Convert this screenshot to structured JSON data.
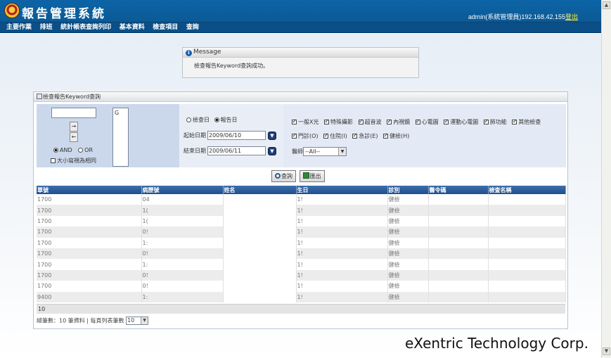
{
  "app": {
    "title": "報告管理系統",
    "user_info": "admin(系統管理員)192.168.42.155",
    "logout": "登出"
  },
  "menu": [
    "主要作業",
    "排班",
    "統計帳表查詢列印",
    "基本資料",
    "檢查項目",
    "查詢"
  ],
  "message": {
    "title": "Message",
    "text": "檢查報告Keyword查詢成功。"
  },
  "panel": {
    "title": "檢查報告Keyword查詢",
    "keyword_input": "",
    "keyword_list": "G",
    "add_arrow": "→",
    "remove_arrow": "←",
    "and_label": "AND",
    "or_label": "OR",
    "logic_selected": "AND",
    "case_label": "大小寫視為相同",
    "date_type": {
      "check_date": "檢查日",
      "report_date": "報告日",
      "selected": "報告日"
    },
    "start_label": "起始日期",
    "start_date": "2009/06/10",
    "end_label": "結束日期",
    "end_date": "2009/06/11",
    "categories_row1": [
      "一般X光",
      "特殊攝影",
      "超音波",
      "內視鏡",
      "心電圖",
      "運動心電圖",
      "肺功能",
      "其他檢查"
    ],
    "categories_row2": [
      "門診(O)",
      "住院(I)",
      "急診(E)",
      "健檢(H)"
    ],
    "doctor_label": "醫師",
    "doctor_value": "--All--",
    "search_button": "查詢",
    "export_button": "匯出"
  },
  "table": {
    "headers": [
      "單號",
      "病歷號",
      "姓名",
      "生日",
      "診別",
      "醫令碼",
      "檢查名稱"
    ],
    "rows": [
      [
        "1700",
        "04",
        "",
        "1!",
        "健檢",
        "",
        ""
      ],
      [
        "1700",
        "1(",
        "",
        "1!",
        "健檢",
        "",
        ""
      ],
      [
        "1700",
        "1(",
        "",
        "1!",
        "健檢",
        "",
        ""
      ],
      [
        "1700",
        "0!",
        "",
        "1!",
        "健檢",
        "",
        ""
      ],
      [
        "1700",
        "1:",
        "",
        "1!",
        "健檢",
        "",
        ""
      ],
      [
        "1700",
        "0!",
        "",
        "1!",
        "健檢",
        "",
        ""
      ],
      [
        "1700",
        "1:",
        "",
        "1!",
        "健檢",
        "",
        ""
      ],
      [
        "1700",
        "0!",
        "",
        "1!",
        "健檢",
        "",
        ""
      ],
      [
        "1700",
        "0!",
        "",
        "1!",
        "健檢",
        "",
        ""
      ],
      [
        "9400",
        "1:",
        "",
        "1!",
        "健檢",
        "",
        ""
      ]
    ],
    "count_row": "10"
  },
  "footer": {
    "total_text": "總筆數：10 筆資料 | 每頁列表筆數",
    "page_size": "10"
  },
  "watermark": "eXentric Technology Corp."
}
